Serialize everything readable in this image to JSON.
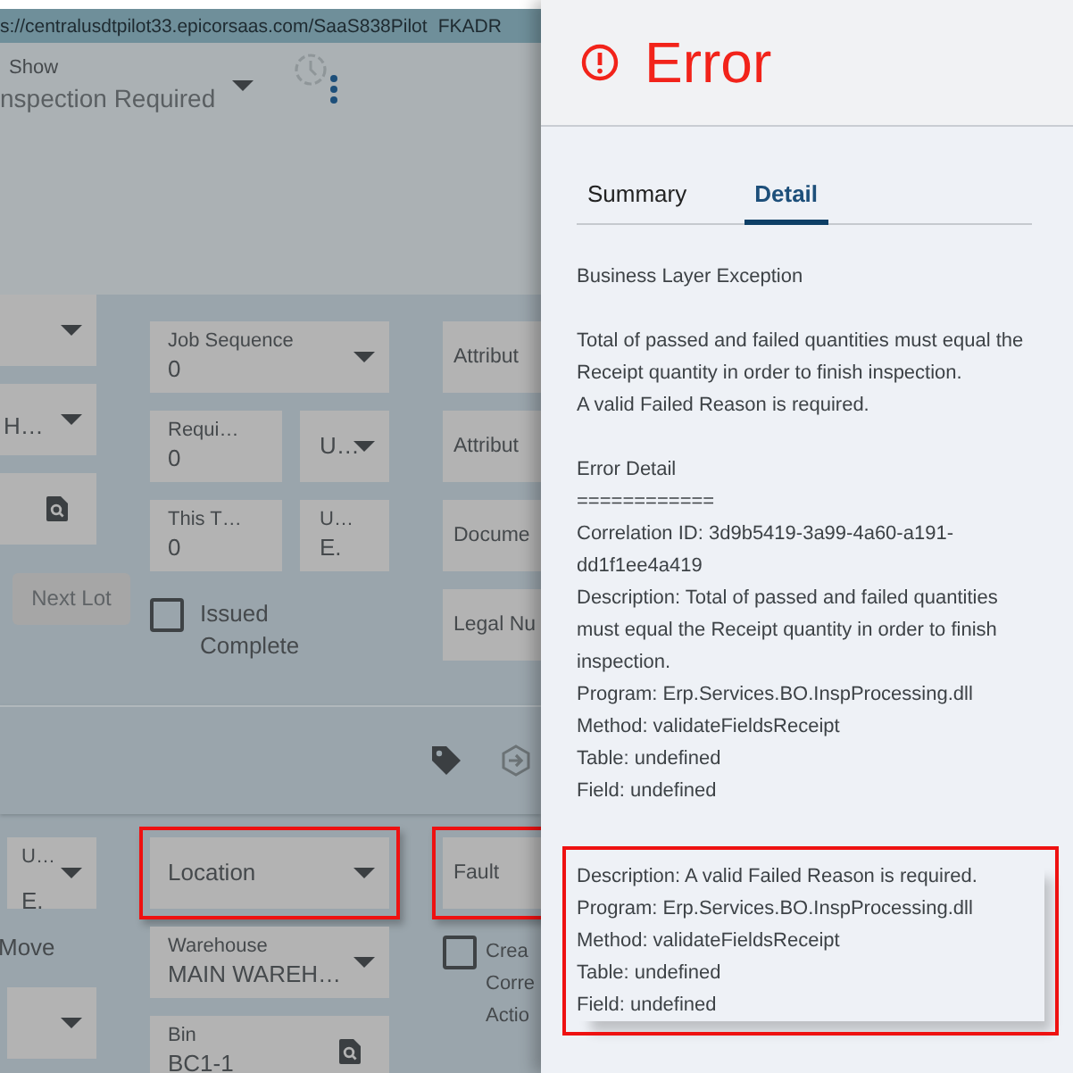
{
  "address_bar": {
    "url": "s://centralusdtpilot33.epicorsaas.com/SaaS838Pilot",
    "user": "FKADR"
  },
  "filter": {
    "label": "Show",
    "value": "nspection Required"
  },
  "upper_form": {
    "column_1": [
      {
        "kind": "dropdown"
      },
      {
        "kind": "dropdown",
        "value": "H…"
      },
      {
        "kind": "lookup"
      },
      {
        "kind": "button",
        "label": "Next Lot",
        "disabled": true
      }
    ],
    "column_2": [
      {
        "kind": "dropdown",
        "label": "Job Sequence",
        "value": "0"
      },
      {
        "kind": "pair",
        "fields": [
          {
            "kind": "field",
            "label": "Requi…",
            "value": "0"
          },
          {
            "kind": "dropdown",
            "label": "U…"
          }
        ]
      },
      {
        "kind": "pair",
        "fields": [
          {
            "kind": "field",
            "label": "This T…",
            "value": "0"
          },
          {
            "kind": "field",
            "label": "U…",
            "value": "E."
          }
        ]
      },
      {
        "kind": "checkbox",
        "label": "Issued Complete",
        "checked": false
      }
    ],
    "column_3": [
      {
        "kind": "field",
        "label": "Attribut"
      },
      {
        "kind": "field",
        "label": "Attribut"
      },
      {
        "kind": "field",
        "label": "Docume"
      },
      {
        "kind": "field",
        "label": "Legal Nu"
      }
    ]
  },
  "lower_form": {
    "column_1": [
      {
        "kind": "dropdown",
        "label": "U…",
        "value": "E."
      },
      {
        "kind": "text",
        "label": "Move"
      },
      {
        "kind": "dropdown"
      }
    ],
    "column_2": [
      {
        "kind": "dropdown",
        "label": "Location",
        "highlighted": true
      },
      {
        "kind": "dropdown",
        "label": "Warehouse",
        "value": "MAIN WAREH…"
      },
      {
        "kind": "lookup",
        "label": "Bin",
        "value": "BC1-1"
      }
    ],
    "column_3": [
      {
        "kind": "field",
        "label": "Fault",
        "highlighted": true
      },
      {
        "kind": "checkbox",
        "label": "Crea Corre Actio",
        "checked": false
      }
    ]
  },
  "error_panel": {
    "title": "Error",
    "tabs": [
      {
        "label": "Summary",
        "selected": false
      },
      {
        "label": "Detail",
        "selected": true
      }
    ],
    "sections": [
      {
        "highlighted": false,
        "lines": [
          "Business Layer Exception"
        ]
      },
      {
        "highlighted": false,
        "lines": [
          "Total of passed and failed quantities must equal the Receipt quantity in order to finish inspection.",
          "A valid Failed Reason is required."
        ]
      },
      {
        "highlighted": false,
        "lines": [
          "Error Detail",
          "============",
          "Correlation ID: 3d9b5419-3a99-4a60-a191-dd1f1ee4a419",
          "Description: Total of passed and failed quantities must equal the Receipt quantity in order to finish inspection.",
          "Program: Erp.Services.BO.InspProcessing.dll",
          "Method: validateFieldsReceipt",
          "Table: undefined",
          "Field: undefined"
        ]
      },
      {
        "highlighted": true,
        "lines": [
          "Description: A valid Failed Reason is required.",
          "Program: Erp.Services.BO.InspProcessing.dll",
          "Method: validateFieldsReceipt",
          "Table: undefined",
          "Field: undefined"
        ]
      }
    ]
  }
}
